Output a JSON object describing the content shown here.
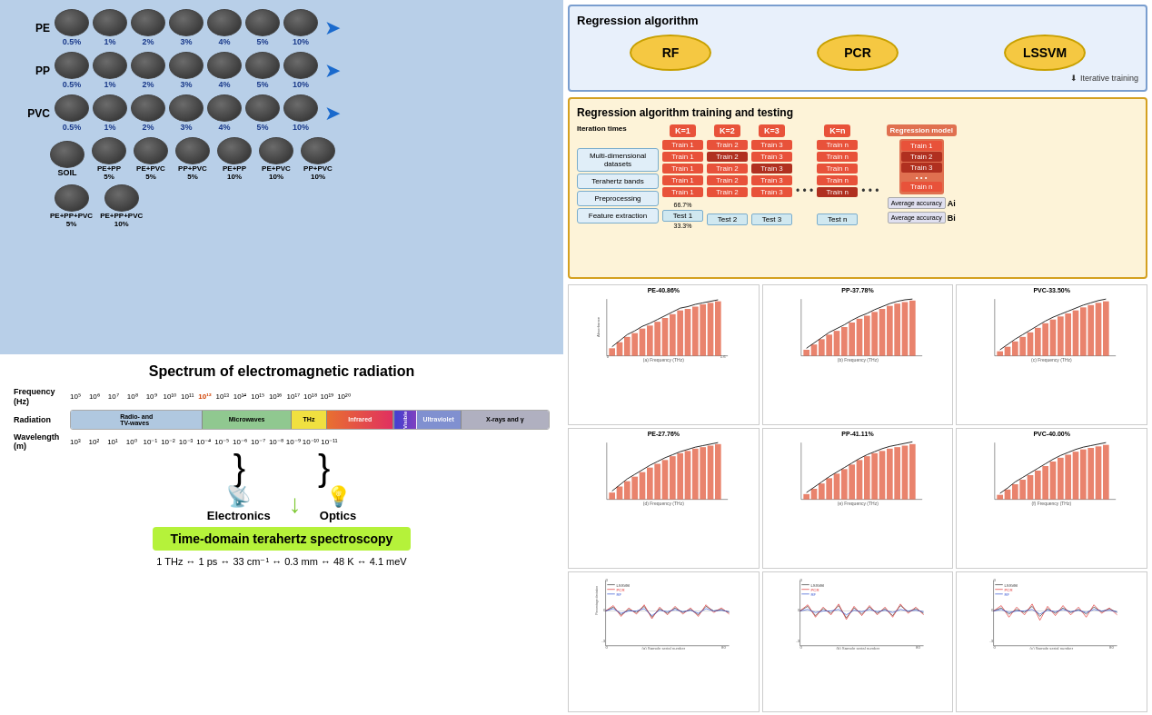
{
  "left": {
    "samples": {
      "rows": [
        {
          "label": "PE",
          "percentages": [
            "0.5%",
            "1%",
            "2%",
            "3%",
            "4%",
            "5%",
            "10%"
          ]
        },
        {
          "label": "PP",
          "percentages": [
            "0.5%",
            "1%",
            "2%",
            "3%",
            "4%",
            "5%",
            "10%"
          ]
        },
        {
          "label": "PVC",
          "percentages": [
            "0.5%",
            "1%",
            "2%",
            "3%",
            "4%",
            "5%",
            "10%"
          ]
        }
      ],
      "mixtures": [
        {
          "label": "SOIL",
          "pct": ""
        },
        {
          "label": "PE+PP\n5%",
          "pct": ""
        },
        {
          "label": "PE+PVC\n5%",
          "pct": ""
        },
        {
          "label": "PP+PVC\n5%",
          "pct": ""
        },
        {
          "label": "PE+PP\n10%",
          "pct": ""
        },
        {
          "label": "PE+PVC\n10%",
          "pct": ""
        },
        {
          "label": "PP+PVC\n10%",
          "pct": ""
        }
      ],
      "mixtures2": [
        {
          "label": "PE+PP+PVC\n5%"
        },
        {
          "label": "PE+PP+PVC\n10%"
        }
      ]
    },
    "spectrum": {
      "title": "Spectrum of electromagnetic radiation",
      "frequency_label": "Frequency\n(Hz)",
      "freq_values": [
        "10⁵",
        "10⁶",
        "10⁷",
        "10⁸",
        "10⁹",
        "10¹⁰",
        "10¹¹",
        "10¹²",
        "10¹³",
        "10¹⁴",
        "10¹⁵",
        "10¹⁶",
        "10¹⁷",
        "10¹⁸",
        "10¹⁹",
        "10²⁰"
      ],
      "radiation_label": "Radiation",
      "radiation_segments": [
        {
          "label": "Radio- and\nTV-waves",
          "color": "#a0c0e8",
          "flex": 3
        },
        {
          "label": "Microwaves",
          "color": "#80d0a0",
          "flex": 2
        },
        {
          "label": "THz",
          "color": "#e8d020",
          "flex": 1
        },
        {
          "label": "Infrared",
          "color": "#e87030",
          "flex": 2
        },
        {
          "label": "Visible",
          "color": "#9060c0",
          "flex": 1
        },
        {
          "label": "Ultraviolet",
          "color": "#6080d0",
          "flex": 1
        },
        {
          "label": "X-rays and γ",
          "color": "#c0c0c0",
          "flex": 2
        }
      ],
      "wavelength_label": "Wavelength\n(m)",
      "wl_values": [
        "10³",
        "10²",
        "10¹",
        "10⁰",
        "10⁻¹",
        "10⁻²",
        "10⁻³",
        "10⁻⁴",
        "10⁻⁵",
        "10⁻⁶",
        "10⁻⁷",
        "10⁻⁸",
        "10⁻⁹",
        "10⁻¹⁰",
        "10⁻¹¹"
      ],
      "electronics_label": "Electronics",
      "optics_label": "Optics",
      "thz_label": "Time-domain terahertz spectroscopy",
      "equiv": "1 THz ↔ 1 ps ↔ 33 cm⁻¹ ↔ 0.3 mm ↔ 48 K ↔ 4.1 meV"
    }
  },
  "right": {
    "algo_section": {
      "title": "Regression algorithm",
      "algorithms": [
        "RF",
        "PCR",
        "LSSVM"
      ],
      "iterative_label": "Iterative training"
    },
    "training_section": {
      "title": "Regression algorithm training and testing",
      "iteration_label": "Iteration times",
      "k_values": [
        "K=1",
        "K=2",
        "K=3",
        "K=n"
      ],
      "multidim_label": "Multi-dimensional\ndatasets",
      "thz_bands_label": "Terahertz bands",
      "preprocessing_label": "Preprocessing",
      "feature_label": "Feature extraction",
      "train_66": "66.7%\ntraining",
      "test_33": "33.3%\ntesting",
      "regression_model_label": "Regression model",
      "avg_accuracy_label": "Average\naccuracy",
      "ai_label": "Ai",
      "bi_label": "Bi",
      "train_rows": [
        [
          "Train 1",
          "Train 2",
          "Train 3",
          "Train n"
        ],
        [
          "Train 1",
          "Train 2",
          "Train 3",
          "Train n"
        ],
        [
          "Train 1",
          "Train 2",
          "Train 3",
          "Train n"
        ],
        [
          "Train 1",
          "Train 2",
          "Train 3",
          "Train n"
        ],
        [
          "Train 1",
          "Train 2",
          "Train 3",
          "Train n"
        ]
      ],
      "test_rows": [
        "Test 1",
        "Test 2",
        "Test 3",
        "Test n"
      ],
      "model_trains": [
        "Train 1",
        "Train 2",
        "Train 3",
        "Train n"
      ],
      "avg_accuracy2_label": "Average accuracy"
    },
    "charts": {
      "top_row": [
        {
          "title": "PE-40.86%",
          "x_label": "(a) Frequency (THz)"
        },
        {
          "title": "PP-37.78%",
          "x_label": "(b) Frequency (THz)"
        },
        {
          "title": "PVC-33.50%",
          "x_label": "(c) Frequency (THz)"
        }
      ],
      "mid_row": [
        {
          "title": "PE-27.76%",
          "x_label": "(d) Frequency (THz)"
        },
        {
          "title": "PP-41.11%",
          "x_label": "(e) Frequency (THz)"
        },
        {
          "title": "PVC-40.00%",
          "x_label": "(f) Frequency (THz)"
        }
      ],
      "bot_row": [
        {
          "title": "",
          "x_label": "(a) Sample serial number",
          "legend": [
            "LSSVM",
            "PCR",
            "RF"
          ]
        },
        {
          "title": "",
          "x_label": "(b) Sample serial number",
          "legend": [
            "LSSVM",
            "PCR",
            "RF"
          ]
        },
        {
          "title": "",
          "x_label": "(c) Sample serial number",
          "legend": [
            "LSSVM",
            "PCR",
            "RF"
          ]
        }
      ],
      "y_label_absorbance": "Absorbance",
      "y_label_deviation": "Percentage deviation"
    }
  }
}
